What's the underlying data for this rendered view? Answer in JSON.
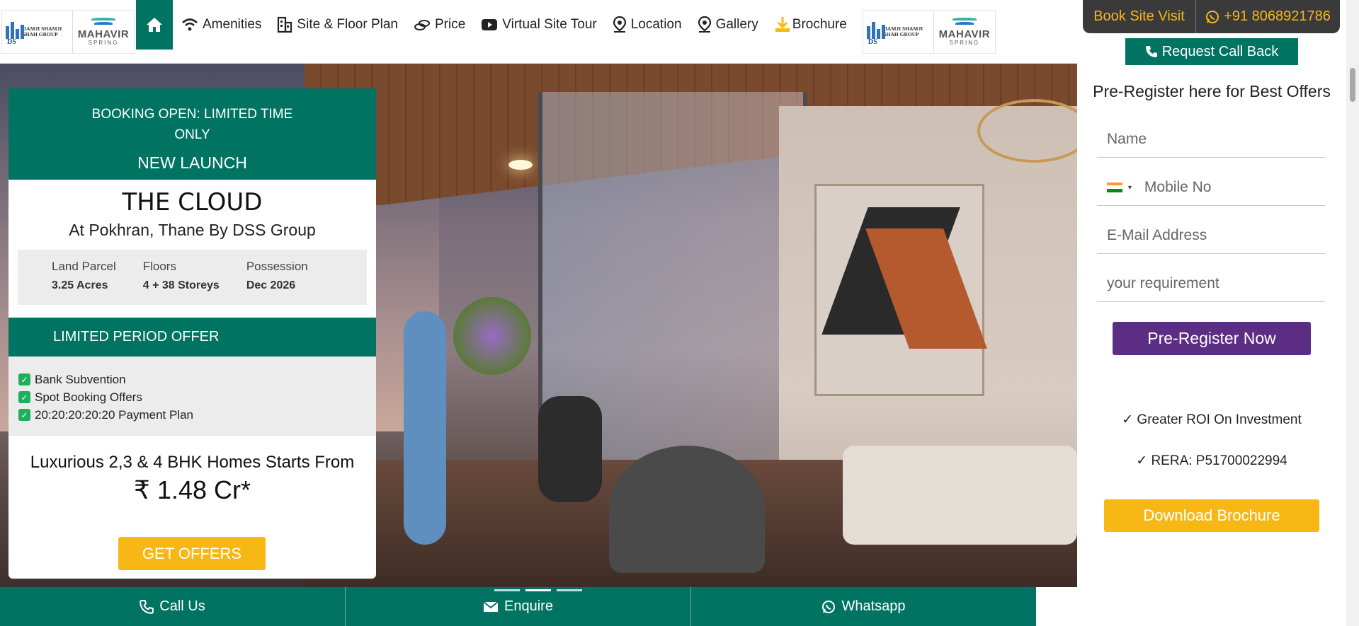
{
  "nav": {
    "logo_group": "DAMJI SHAMJI SHAH GROUP",
    "logo_mark": "DS",
    "logo_since": "SINCE 1965",
    "logo_project": "MAHAVIR",
    "logo_project_sub": "SPRING",
    "items": [
      {
        "label": "Amenities",
        "icon": "wifi-icon"
      },
      {
        "label": "Site & Floor Plan",
        "icon": "building-icon"
      },
      {
        "label": "Price",
        "icon": "money-icon"
      },
      {
        "label": "Virtual Site Tour",
        "icon": "youtube-icon"
      },
      {
        "label": "Location",
        "icon": "map-pin-icon"
      },
      {
        "label": "Gallery",
        "icon": "map-pin-icon"
      },
      {
        "label": "Brochure",
        "icon": "download-icon"
      }
    ]
  },
  "sidebar": {
    "book_visit": "Book Site Visit",
    "phone": "+91 8068921786",
    "callback": "Request Call Back",
    "form_title": "Pre-Register here for Best Offers",
    "name_placeholder": "Name",
    "mobile_placeholder": "Mobile No",
    "email_placeholder": "E-Mail Address",
    "requirement_placeholder": "your requirement",
    "submit": "Pre-Register Now",
    "bullet1": "✓ Greater ROI On Investment",
    "bullet2": "✓ RERA: P51700022994",
    "download": "Download Brochure"
  },
  "card": {
    "booking": "BOOKING OPEN: LIMITED TIME ONLY",
    "launch": "NEW LAUNCH",
    "title": "THE CLOUD",
    "subtitle": "At Pokhran, Thane By DSS Group",
    "stats": [
      {
        "label": "Land Parcel",
        "value": "3.25 Acres"
      },
      {
        "label": "Floors",
        "value": "4 + 38 Storeys"
      },
      {
        "label": "Possession",
        "value": "Dec 2026"
      }
    ],
    "offer_title": "LIMITED PERIOD OFFER",
    "offers": [
      "Bank Subvention",
      "Spot Booking Offers",
      "20:20:20:20:20 Payment Plan"
    ],
    "homes": "Luxurious 2,3 & 4 BHK Homes Starts From",
    "price": "₹ 1.48 Cr*",
    "cta": "GET OFFERS"
  },
  "bottom": {
    "call": "Call Us",
    "enquire": "Enquire",
    "whatsapp": "Whatsapp"
  },
  "colors": {
    "primary": "#007363",
    "accent": "#f7b815",
    "purple": "#5b2e83"
  }
}
